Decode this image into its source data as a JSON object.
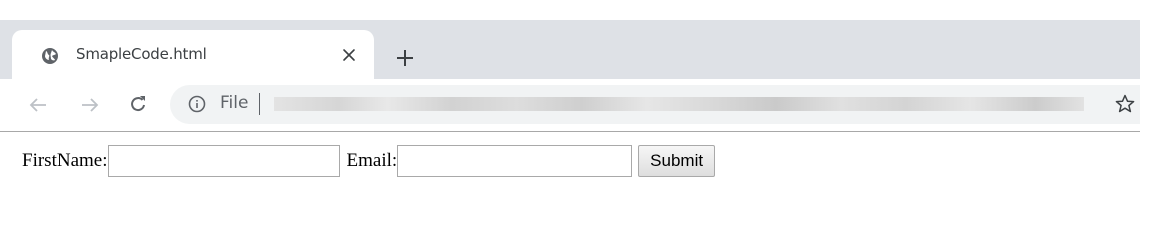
{
  "browser": {
    "tab": {
      "title": "SmapleCode.html",
      "favicon": "globe-icon",
      "close_icon": "close-icon"
    },
    "new_tab_icon": "plus-icon",
    "toolbar": {
      "back_icon": "arrow-left-icon",
      "forward_icon": "arrow-right-icon",
      "reload_icon": "reload-icon",
      "omnibox": {
        "info_icon": "info-icon",
        "scheme": "File",
        "separator": "|",
        "url_redacted": true
      },
      "bookmark_icon": "star-icon"
    },
    "colors": {
      "tabstrip_bg": "#dee1e6",
      "omnibox_bg": "#f1f3f4",
      "icon_color": "#5f6368",
      "disabled_icon_color": "#bdc1c6"
    }
  },
  "page": {
    "form": {
      "firstname_label": "FirstName:",
      "firstname_value": "",
      "email_label": "Email:",
      "email_value": "",
      "submit_label": "Submit"
    }
  }
}
